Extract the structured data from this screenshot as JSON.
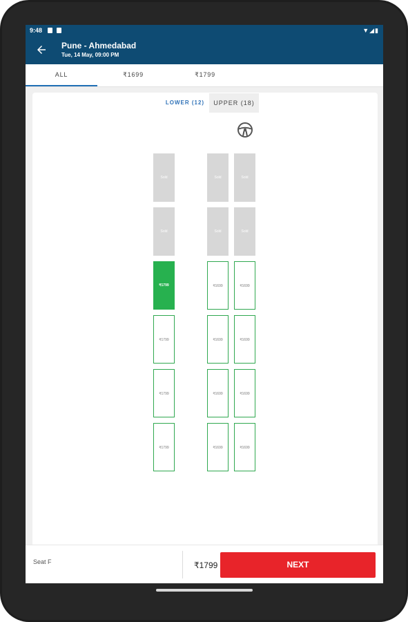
{
  "status_bar": {
    "time": "9:48",
    "right_icons": "▼◢▮"
  },
  "app_bar": {
    "title": "Pune - Ahmedabad",
    "subtitle": "Tue, 14 May,  09:00 PM"
  },
  "tabs": [
    {
      "label": "ALL",
      "active": true
    },
    {
      "label": "₹1699",
      "active": false
    },
    {
      "label": "₹1799",
      "active": false
    }
  ],
  "deck_tabs": {
    "lower": "LOWER (12)",
    "upper": "UPPER (18)"
  },
  "seats": [
    {
      "label": "Sold",
      "state": "booked"
    },
    {
      "label": "Sold",
      "state": "booked"
    },
    {
      "label": "Sold",
      "state": "booked"
    },
    {
      "label": "Sold",
      "state": "booked"
    },
    {
      "label": "Sold",
      "state": "booked"
    },
    {
      "label": "Sold",
      "state": "booked"
    },
    {
      "label": "₹1799",
      "state": "selected"
    },
    {
      "label": "₹1699",
      "state": "available"
    },
    {
      "label": "₹1699",
      "state": "available"
    },
    {
      "label": "₹1799",
      "state": "available"
    },
    {
      "label": "₹1699",
      "state": "available"
    },
    {
      "label": "₹1699",
      "state": "available"
    },
    {
      "label": "₹1799",
      "state": "available"
    },
    {
      "label": "₹1699",
      "state": "available"
    },
    {
      "label": "₹1699",
      "state": "available"
    },
    {
      "label": "₹1799",
      "state": "available"
    },
    {
      "label": "₹1699",
      "state": "available"
    },
    {
      "label": "₹1699",
      "state": "available"
    }
  ],
  "bottom_bar": {
    "seat_label": "Seat F",
    "price": "₹1799",
    "next_label": "NEXT"
  },
  "colors": {
    "primary": "#0e4b73",
    "selected_seat": "#27b14f",
    "available_border": "#2fa84f",
    "booked_seat": "#d7d7d7",
    "next_button": "#e8242a",
    "active_tab": "#2f72b8"
  },
  "icons": {
    "back": "arrow-left-icon",
    "steering": "steering-wheel-icon"
  }
}
